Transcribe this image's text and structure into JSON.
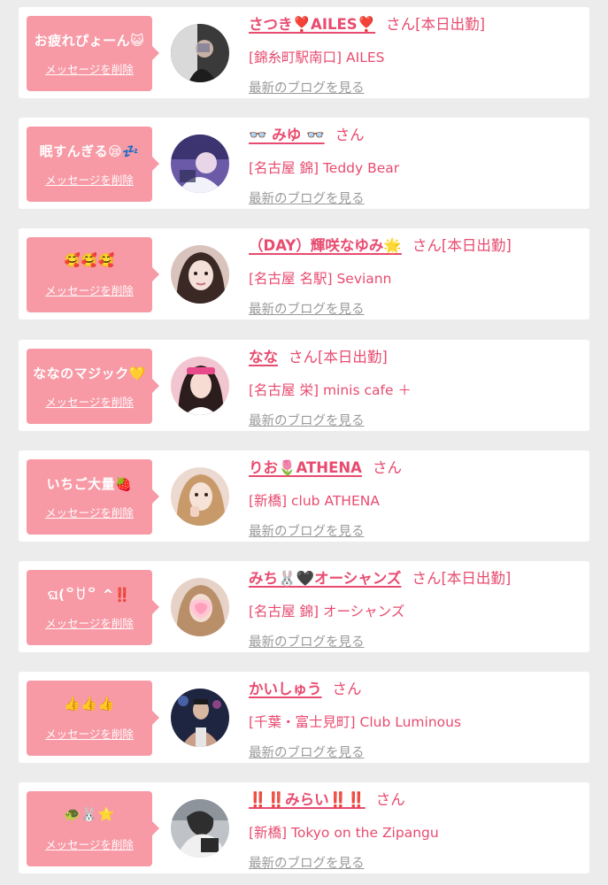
{
  "blog_link_label": "最新のブログを見る",
  "delete_label": "メッセージを削除",
  "colors": {
    "background": "#ececec",
    "card": "#ffffff",
    "bubble": "#f79aa6",
    "accent": "#e84b6f",
    "link_gray": "#9a9a9a"
  },
  "entries": [
    {
      "message": "お疲れぴょーん😺",
      "name": "さつき❣️AILES❣️",
      "honorific": "さん",
      "shift": "[本日出勤]",
      "shop": "[錦糸町駅南口] AILES",
      "avatar_icon": "girl-photo-avatar"
    },
    {
      "message": "眠すんぎる😪💤",
      "name": "👓 みゆ 👓",
      "honorific": "さん",
      "shift": "",
      "shop": "[名古屋 錦] Teddy Bear",
      "avatar_icon": "girl-photo-avatar"
    },
    {
      "message": "🥰🥰🥰",
      "name": "（DAY）輝咲なゆみ🌟",
      "honorific": "さん",
      "shift": "[本日出勤]",
      "shop": "[名古屋 名駅] Seviann",
      "avatar_icon": "girl-photo-avatar"
    },
    {
      "message": "ななのマジック💛",
      "name": "なな",
      "honorific": "さん",
      "shift": "[本日出勤]",
      "shop": "[名古屋 栄] minis cafe ＋",
      "avatar_icon": "girl-photo-avatar"
    },
    {
      "message": "いちご大量🍓",
      "name": "りお🌷ATHENA",
      "honorific": "さん",
      "shift": "",
      "shop": "[新橋] club ATHENA",
      "avatar_icon": "girl-photo-avatar"
    },
    {
      "message": "ଘ(꒪ꇴ꒪ ^‼️",
      "name": "みち🐰🖤オーシャンズ",
      "honorific": "さん",
      "shift": "[本日出勤]",
      "shop": "[名古屋 錦] オーシャンズ",
      "avatar_icon": "girl-photo-avatar"
    },
    {
      "message": "👍👍👍",
      "name": "かいしゅう",
      "honorific": "さん",
      "shift": "",
      "shop": "[千葉・富士見町] Club Luminous",
      "avatar_icon": "host-photo-avatar"
    },
    {
      "message": "🐢🐰⭐",
      "name": "‼️‼️みらい‼️‼️",
      "honorific": "さん",
      "shift": "",
      "shop": "[新橋] Tokyo on the Zipangu",
      "avatar_icon": "girl-photo-avatar"
    }
  ]
}
